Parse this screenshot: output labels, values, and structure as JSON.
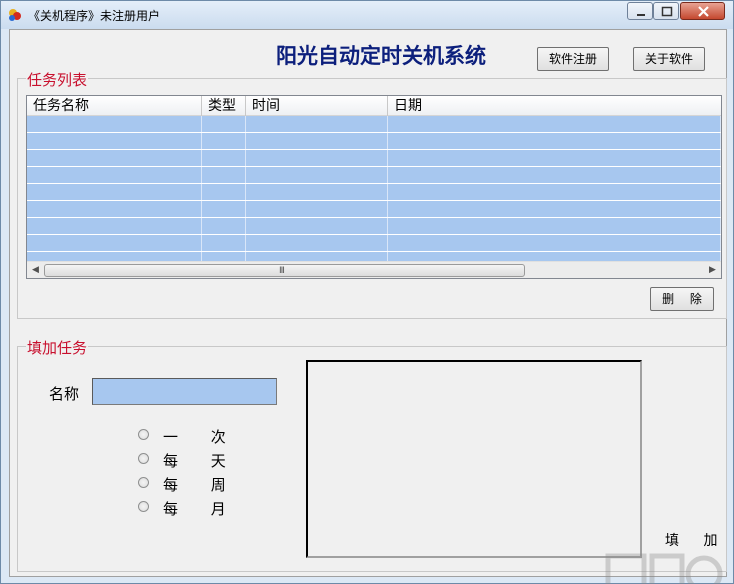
{
  "window": {
    "title": "《关机程序》未注册用户",
    "icon": "app-icon"
  },
  "header": {
    "app_title": "阳光自动定时关机系统",
    "register_button": "软件注册",
    "about_button": "关于软件"
  },
  "tasks": {
    "group_label": "任务列表",
    "columns": [
      "任务名称",
      "类型",
      "时间",
      "日期"
    ],
    "row_count": 9,
    "delete_button": "删 除"
  },
  "add_task": {
    "group_label": "填加任务",
    "name_label": "名称",
    "name_value": "",
    "frequency_options": [
      "一 次",
      "每 天",
      "每 周",
      "每 月"
    ],
    "add_button": "填 加"
  },
  "colors": {
    "title": "#0c1f7c",
    "group_label": "#c8102e",
    "selection": "#a7c7ef",
    "window_frame": "#dce8f5"
  }
}
